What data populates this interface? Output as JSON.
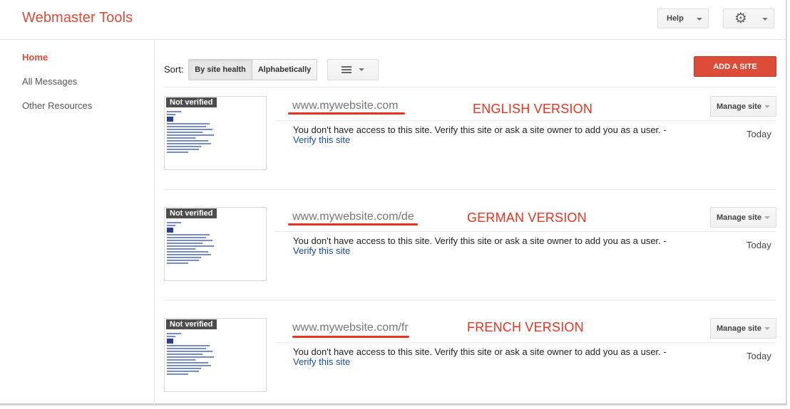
{
  "header": {
    "app_title": "Webmaster Tools",
    "help_label": "Help",
    "settings_icon": "gear-icon"
  },
  "sidebar": {
    "items": [
      {
        "label": "Home",
        "active": true
      },
      {
        "label": "All Messages",
        "active": false
      },
      {
        "label": "Other Resources",
        "active": false
      }
    ]
  },
  "toolbar": {
    "sort_label": "Sort:",
    "sort_options": [
      "By site health",
      "Alphabetically"
    ],
    "selected_sort": "By site health",
    "view_icon": "list-view-icon",
    "add_site_label": "ADD A SITE"
  },
  "sites": [
    {
      "badge": "Not verified",
      "url": "www.mywebsite.com",
      "annotation": "ENGLISH VERSION",
      "message": "You don't have access to this site. Verify this site or ask a site owner to add you as a user. -",
      "verify_link": "Verify this site",
      "manage_label": "Manage site",
      "date": "Today"
    },
    {
      "badge": "Not verified",
      "url": "www.mywebsite.com/de",
      "annotation": "GERMAN VERSION",
      "message": "You don't have access to this site. Verify this site or ask a site owner to add you as a user. -",
      "verify_link": "Verify this site",
      "manage_label": "Manage site",
      "date": "Today"
    },
    {
      "badge": "Not verified",
      "url": "www.mywebsite.com/fr",
      "annotation": "FRENCH VERSION",
      "message": "You don't have access to this site. Verify this site or ask a site owner to add you as a user. -",
      "verify_link": "Verify this site",
      "manage_label": "Manage site",
      "date": "Today"
    }
  ],
  "colors": {
    "brand_red": "#dd4b39",
    "annotation_red": "#e8331f",
    "link_blue": "#1a4ea4"
  }
}
